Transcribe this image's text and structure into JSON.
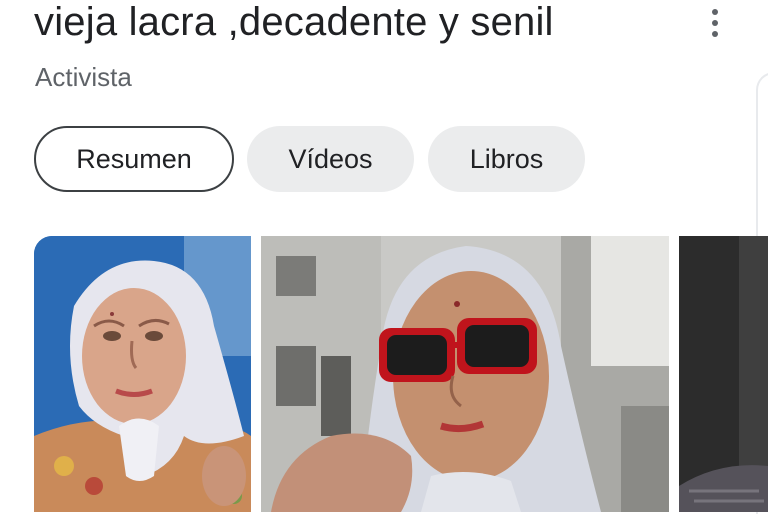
{
  "header": {
    "title": "vieja lacra ,decadente y senil",
    "subtitle": "Activista",
    "menu_icon": "more-vert-icon"
  },
  "tabs": [
    {
      "label": "Resumen",
      "selected": true
    },
    {
      "label": "Vídeos",
      "selected": false
    },
    {
      "label": "Libros",
      "selected": false
    }
  ],
  "images": [
    {
      "name": "photo-woman-white-headscarf"
    },
    {
      "name": "photo-woman-red-sunglasses"
    },
    {
      "name": "photo-partial-dark"
    }
  ],
  "colors": {
    "chip_bg": "#ebeced",
    "chip_border": "#3c4043",
    "text": "#202124",
    "subtle_text": "#5f6368"
  }
}
